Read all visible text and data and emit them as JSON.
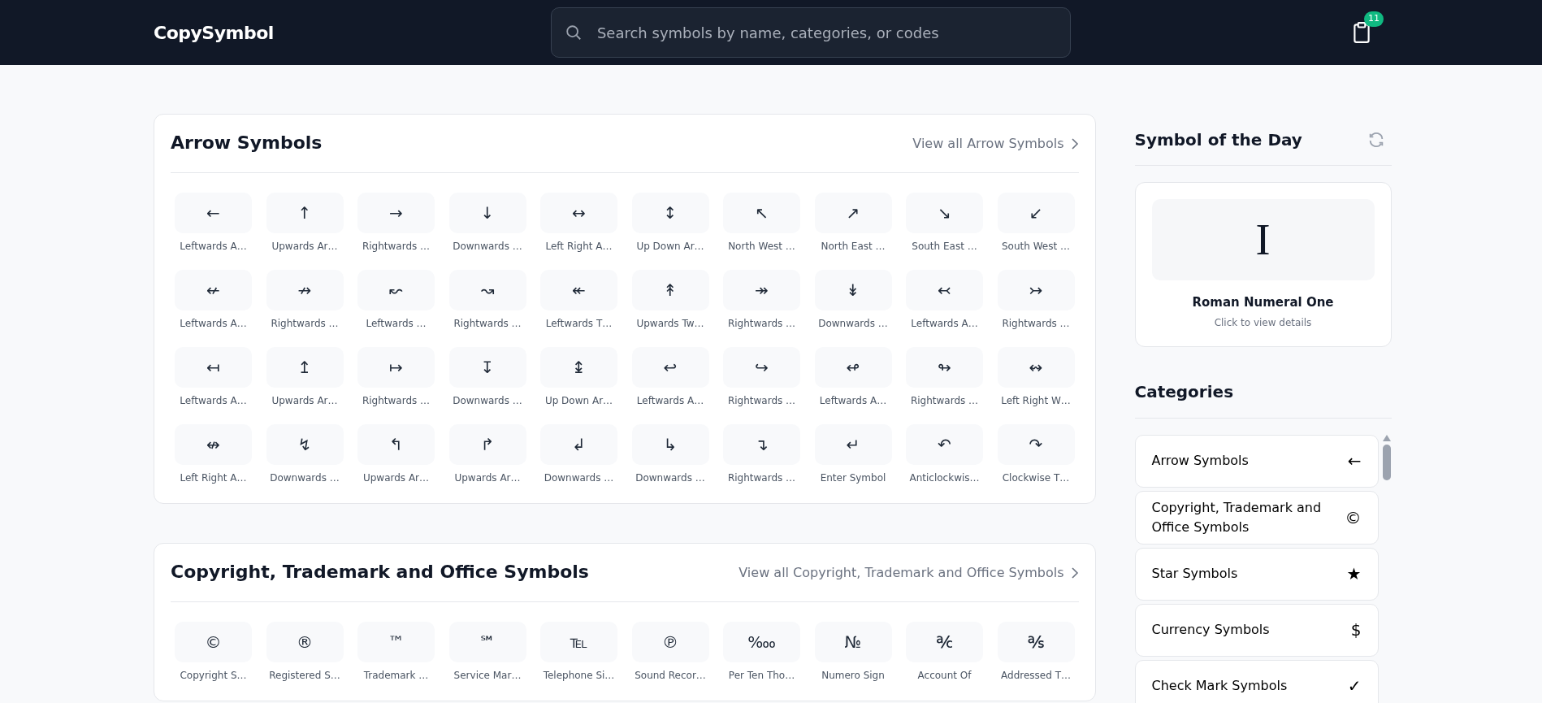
{
  "header": {
    "logo": "CopySymbol",
    "search": {
      "placeholder": "Search symbols by name, categories, or codes"
    },
    "clipboard_count": "11"
  },
  "sections": [
    {
      "title": "Arrow Symbols",
      "view_all": "View all Arrow Symbols",
      "symbols": [
        {
          "char": "←",
          "label": "Leftwards A…"
        },
        {
          "char": "↑",
          "label": "Upwards Ar…"
        },
        {
          "char": "→",
          "label": "Rightwards …"
        },
        {
          "char": "↓",
          "label": "Downwards …"
        },
        {
          "char": "↔",
          "label": "Left Right A…"
        },
        {
          "char": "↕",
          "label": "Up Down Ar…"
        },
        {
          "char": "↖",
          "label": "North West …"
        },
        {
          "char": "↗",
          "label": "North East …"
        },
        {
          "char": "↘",
          "label": "South East …"
        },
        {
          "char": "↙",
          "label": "South West …"
        },
        {
          "char": "↚",
          "label": "Leftwards A…"
        },
        {
          "char": "↛",
          "label": "Rightwards …"
        },
        {
          "char": "↜",
          "label": "Leftwards …"
        },
        {
          "char": "↝",
          "label": "Rightwards …"
        },
        {
          "char": "↞",
          "label": "Leftwards T…"
        },
        {
          "char": "↟",
          "label": "Upwards Tw…"
        },
        {
          "char": "↠",
          "label": "Rightwards …"
        },
        {
          "char": "↡",
          "label": "Downwards …"
        },
        {
          "char": "↢",
          "label": "Leftwards A…"
        },
        {
          "char": "↣",
          "label": "Rightwards …"
        },
        {
          "char": "↤",
          "label": "Leftwards A…"
        },
        {
          "char": "↥",
          "label": "Upwards Ar…"
        },
        {
          "char": "↦",
          "label": "Rightwards …"
        },
        {
          "char": "↧",
          "label": "Downwards …"
        },
        {
          "char": "↨",
          "label": "Up Down Ar…"
        },
        {
          "char": "↩",
          "label": "Leftwards A…"
        },
        {
          "char": "↪",
          "label": "Rightwards …"
        },
        {
          "char": "↫",
          "label": "Leftwards A…"
        },
        {
          "char": "↬",
          "label": "Rightwards …"
        },
        {
          "char": "↭",
          "label": "Left Right W…"
        },
        {
          "char": "↮",
          "label": "Left Right A…"
        },
        {
          "char": "↯",
          "label": "Downwards …"
        },
        {
          "char": "↰",
          "label": "Upwards Ar…"
        },
        {
          "char": "↱",
          "label": "Upwards Ar…"
        },
        {
          "char": "↲",
          "label": "Downwards …"
        },
        {
          "char": "↳",
          "label": "Downwards …"
        },
        {
          "char": "↴",
          "label": "Rightwards …"
        },
        {
          "char": "↵",
          "label": "Enter Symbol"
        },
        {
          "char": "↶",
          "label": "Anticlockwis…"
        },
        {
          "char": "↷",
          "label": "Clockwise T…"
        }
      ]
    },
    {
      "title": "Copyright, Trademark and Office Symbols",
      "view_all": "View all Copyright, Trademark and Office Symbols",
      "symbols": [
        {
          "char": "©",
          "label": "Copyright S…"
        },
        {
          "char": "®",
          "label": "Registered S…"
        },
        {
          "char": "™",
          "label": "Trademark …"
        },
        {
          "char": "℠",
          "label": "Service Mar…"
        },
        {
          "char": "℡",
          "label": "Telephone Si…"
        },
        {
          "char": "℗",
          "label": "Sound Recor…"
        },
        {
          "char": "‱",
          "label": "Per Ten Tho…"
        },
        {
          "char": "№",
          "label": "Numero Sign"
        },
        {
          "char": "℀",
          "label": "Account Of"
        },
        {
          "char": "℁",
          "label": "Addressed T…"
        }
      ]
    }
  ],
  "symbol_of_the_day": {
    "title": "Symbol of the Day",
    "char": "I",
    "name": "Roman Numeral One",
    "hint": "Click to view details"
  },
  "categories": {
    "title": "Categories",
    "items": [
      {
        "label": "Arrow Symbols",
        "char": "←"
      },
      {
        "label": "Copyright, Trademark and Office Symbols",
        "char": "©"
      },
      {
        "label": "Star Symbols",
        "char": "★"
      },
      {
        "label": "Currency Symbols",
        "char": "$"
      },
      {
        "label": "Check Mark Symbols",
        "char": "✓"
      }
    ]
  }
}
